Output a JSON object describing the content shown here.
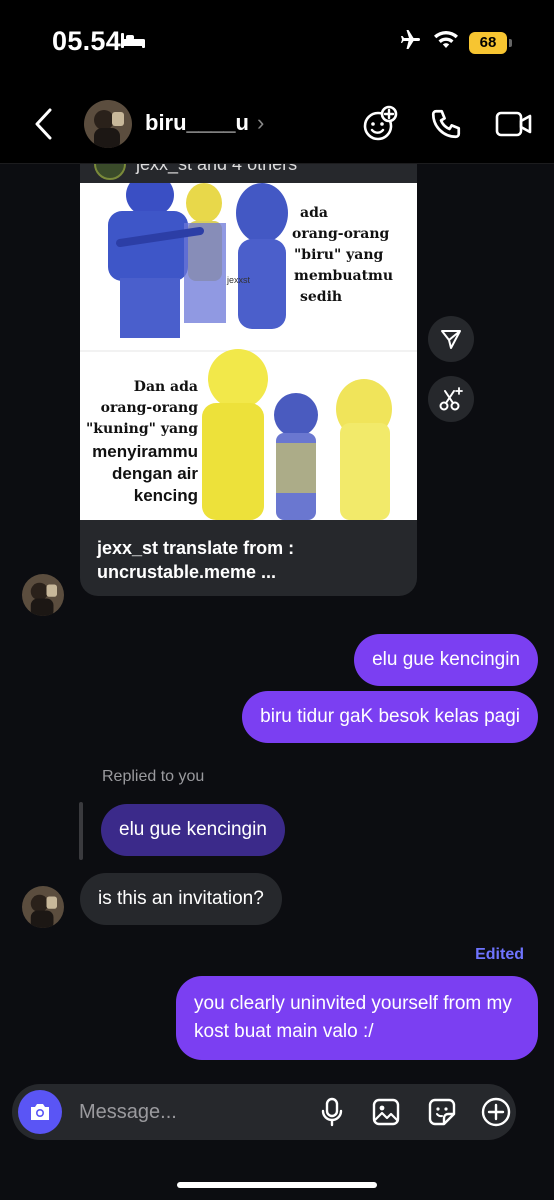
{
  "status_bar": {
    "time": "05.54",
    "battery": "68"
  },
  "header": {
    "contact_name": "biru____u"
  },
  "shared_post": {
    "owner": "jexx_st and 4 others",
    "caption": "jexx_st translate from : uncrustable.meme ...",
    "image_text": {
      "watermark": "jexxst",
      "top_text": [
        "ada",
        "orang-orang",
        "\"biru\" yang",
        "membuatmu",
        "sedih"
      ],
      "bottom_text": [
        "Dan ada",
        "orang-orang",
        "\"kuning\" yang",
        "menyirammu",
        "dengan air",
        "kencing"
      ]
    }
  },
  "messages": {
    "out_1": "elu gue kencingin",
    "out_2": "biru tidur gaK besok kelas pagi",
    "replied_label": "Replied to you",
    "reply_quote": "elu gue kencingin",
    "in_1": "is this an invitation?",
    "edited_label": "Edited",
    "out_3": "you clearly uninvited yourself from my kost buat main valo :/"
  },
  "composer": {
    "placeholder": "Message..."
  },
  "colors": {
    "outgoing_bubble": "#7b3ff2",
    "incoming_bubble": "#26282c",
    "reply_quote": "#3b2a8a",
    "accent": "#5a55f5",
    "battery": "#f7c531"
  }
}
